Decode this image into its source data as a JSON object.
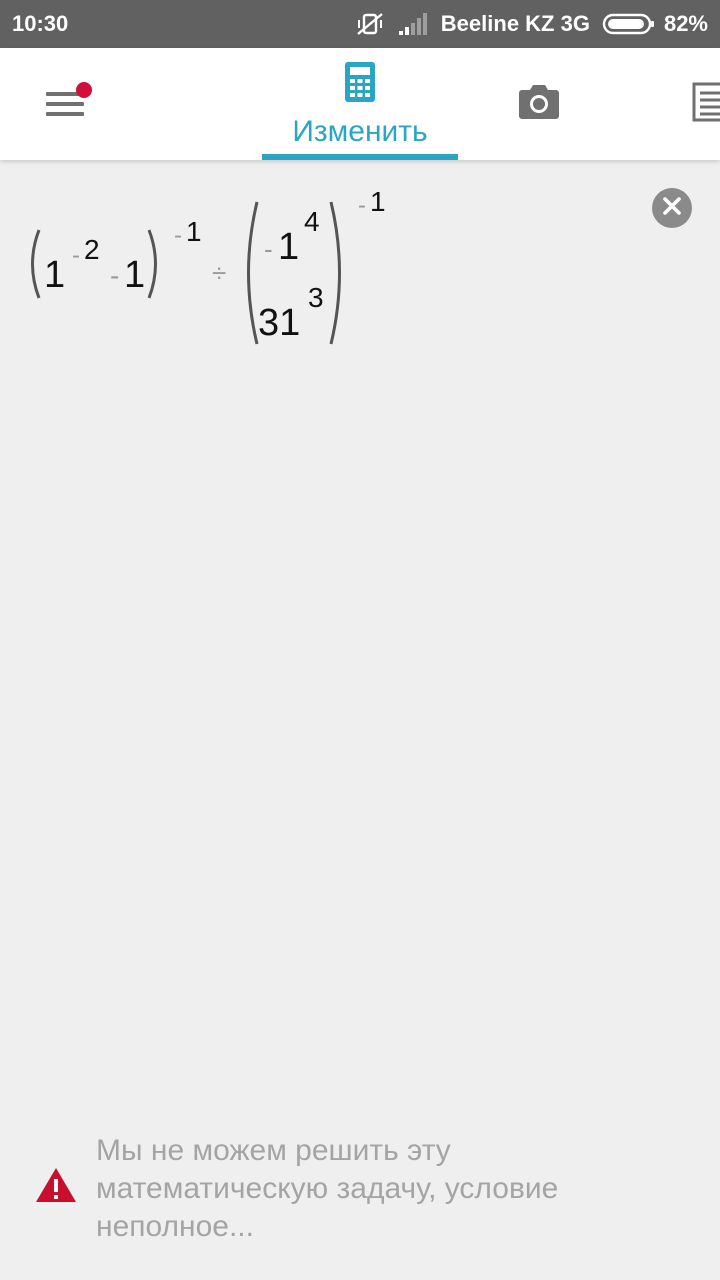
{
  "status_bar": {
    "time": "10:30",
    "carrier": "Beeline KZ 3G",
    "battery": "82%",
    "icons": [
      "vibrate-off-icon",
      "signal-icon",
      "battery-icon"
    ]
  },
  "toolbar": {
    "tab_edit_label": "Изменить",
    "accent_color": "#2aa6c4",
    "badge_color": "#d0103a",
    "icons": [
      "menu-icon",
      "calculator-icon",
      "camera-icon",
      "notes-icon"
    ]
  },
  "expression": {
    "left_base": "1",
    "left_exp_minus": "-",
    "left_exp": "2",
    "left_minus": "-",
    "left_term": "1",
    "left_outer_minus": "-",
    "left_outer_exp": "1",
    "operator": "÷",
    "num_minus": "-",
    "num_base": "1",
    "num_exp": "4",
    "den_base": "31",
    "den_exp": "3",
    "right_outer_minus": "-",
    "right_outer_exp": "1"
  },
  "warning": {
    "text": "Мы не можем решить эту математическую задачу, условие неполное...",
    "icon_color": "#c8102e"
  }
}
